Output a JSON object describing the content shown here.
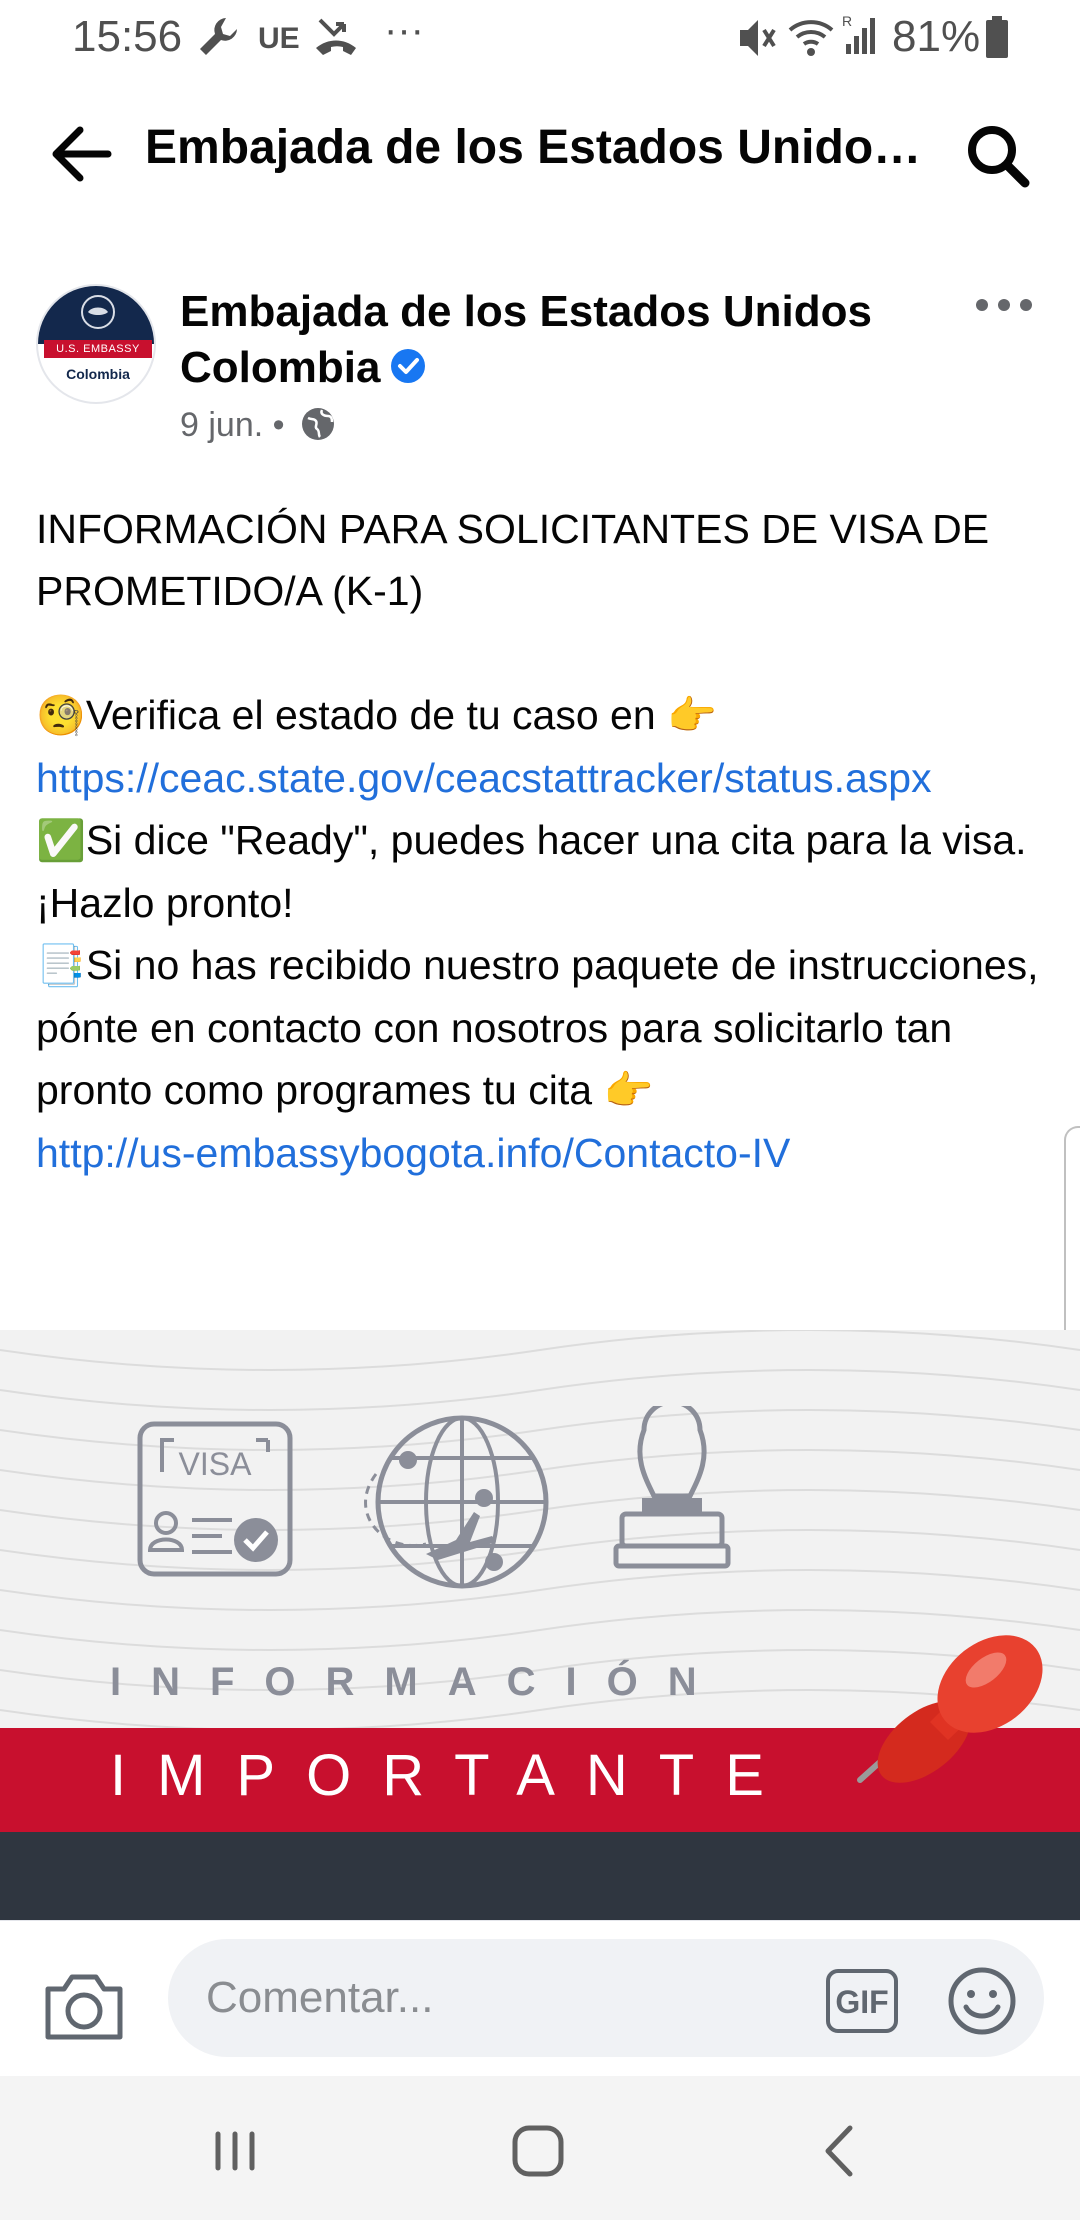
{
  "status_bar": {
    "time": "15:56",
    "carrier_badge": "UE",
    "battery": "81%",
    "icons": [
      "wrench-icon",
      "missed-call-icon",
      "more-notifications-icon",
      "mute-icon",
      "wifi-icon",
      "signal-icon",
      "battery-icon"
    ]
  },
  "app_bar": {
    "title": "Embajada de los Estados Unidos Colombia",
    "back_icon": "arrow-left-icon",
    "search_icon": "search-icon"
  },
  "post": {
    "author": {
      "name": "Embajada de los Estados Unidos Colombia",
      "verified": true,
      "avatar_band_text": "U.S. EMBASSY",
      "avatar_country_text": "Colombia"
    },
    "date": "9 jun.",
    "separator": "•",
    "privacy_icon": "globe-icon",
    "body": {
      "heading": "INFORMACIÓN PARA SOLICITANTES DE VISA DE PROMETIDO/A (K-1)",
      "line1_emoji": "🧐",
      "line1_text": "Verifica el estado de tu caso en",
      "line1_pointer": "👉",
      "link1": "https://ceac.state.gov/ceacstattracker/status.aspx",
      "line2_emoji": "✅",
      "line2_text": "Si dice \"Ready\", puedes hacer una cita para la visa. ¡Hazlo pronto!",
      "line3_emoji": "📑",
      "line3_text": "Si no has recibido nuestro paquete de instrucciones, pónte en contacto con nosotros para solicitarlo tan pronto como programes tu cita",
      "line3_pointer": "👉",
      "link2": "http://us-embassybogota.info/Contacto-IV"
    },
    "image": {
      "visa_card_text": "VISA",
      "caption_top": "INFORMACIÓN",
      "caption_main": "IMPORTANTE",
      "icons": [
        "visa-card-icon",
        "globe-plane-icon",
        "rubber-stamp-icon",
        "pushpin-icon"
      ],
      "colors": {
        "red": "#c8102e",
        "dark": "#2f3640",
        "gray": "#8b8e99"
      }
    }
  },
  "comment_bar": {
    "placeholder": "Comentar...",
    "gif_label": "GIF",
    "camera_icon": "camera-icon",
    "emoji_icon": "smiley-icon"
  },
  "nav_bar": {
    "icons": [
      "recent-apps-icon",
      "home-icon",
      "back-icon"
    ]
  },
  "colors": {
    "link": "#216fdb",
    "verified": "#1877f2",
    "meta": "#65676b"
  }
}
